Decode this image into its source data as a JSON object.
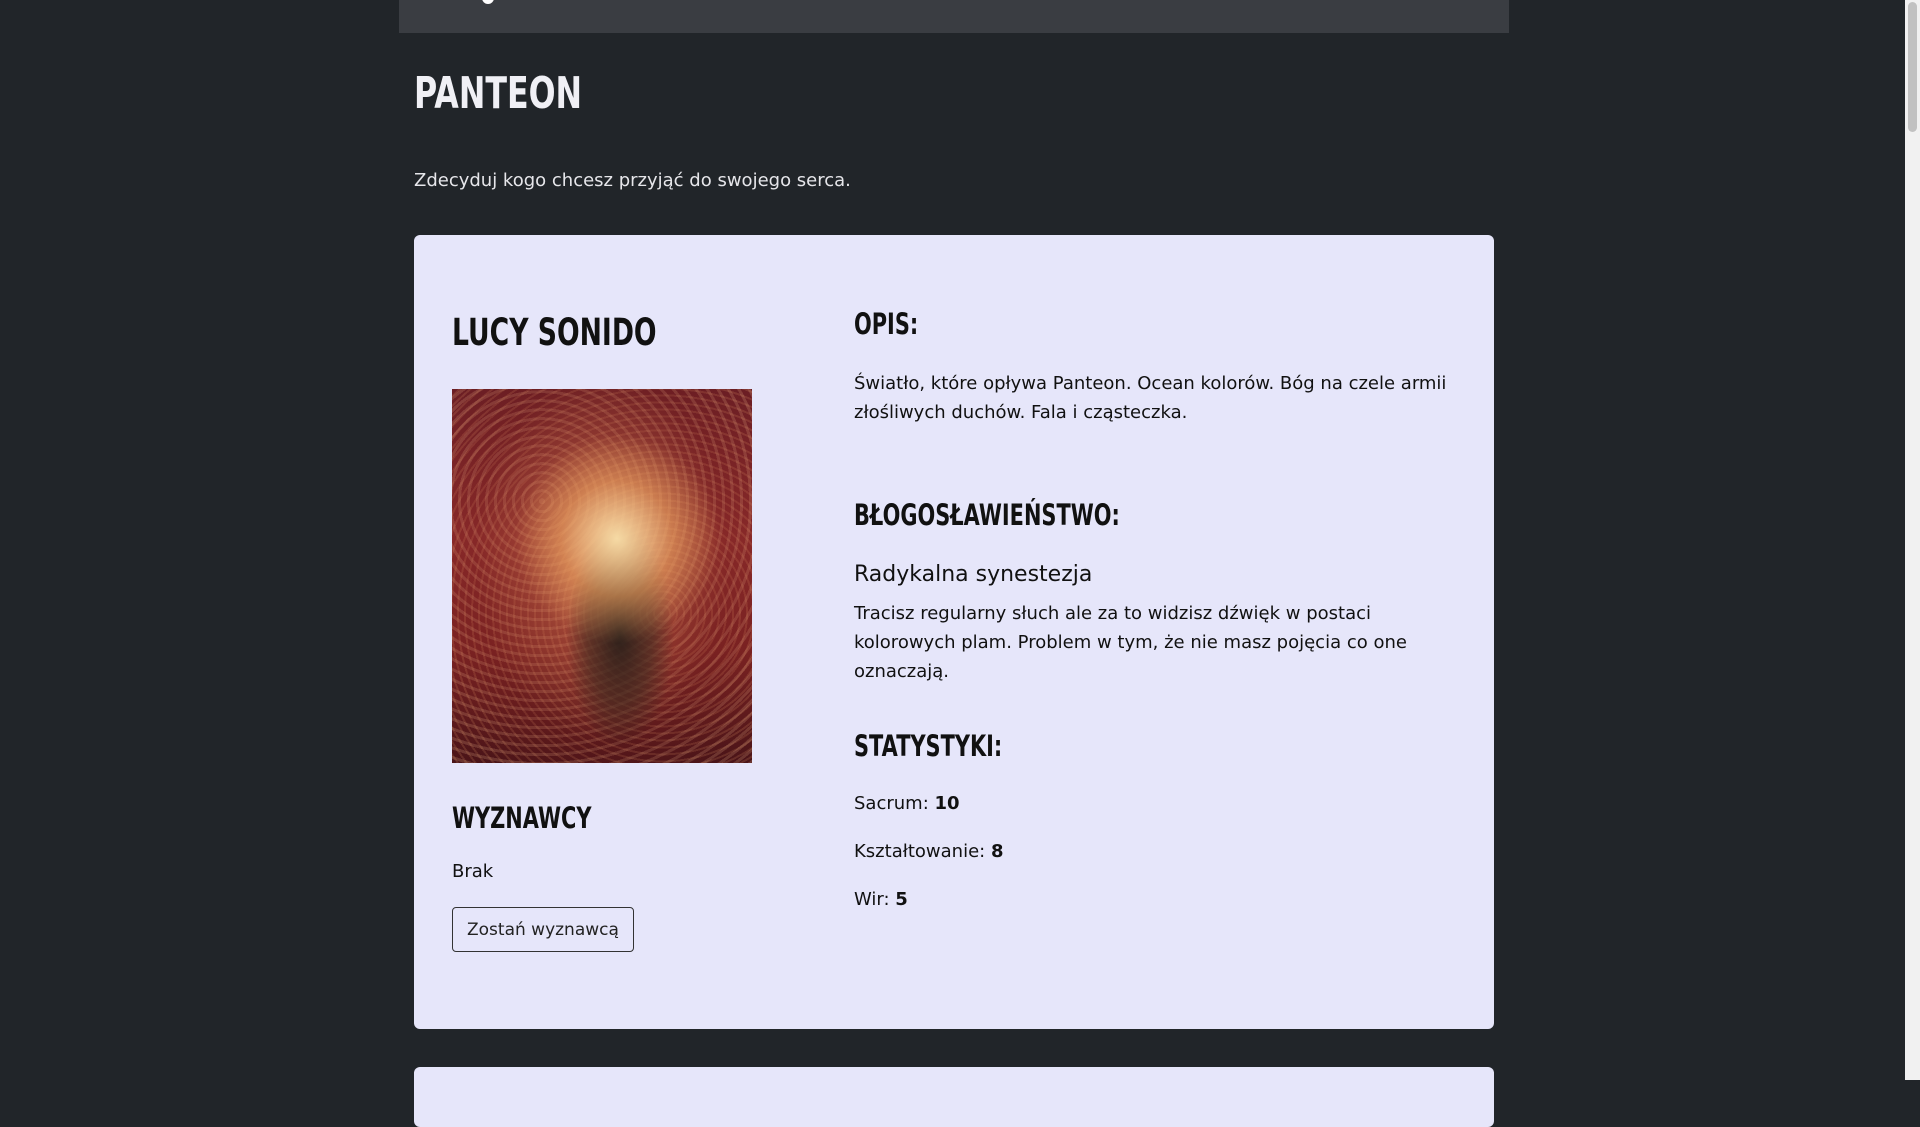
{
  "page": {
    "title": "PANTEON",
    "subtitle": "Zdecyduj kogo chcesz przyjąć do swojego serca."
  },
  "god": {
    "name": "LUCY SONIDO",
    "image_alt": "Lucy Sonido",
    "followers_heading": "WYZNAWCY",
    "followers_value": "Brak",
    "follow_button_label": "Zostań wyznawcą",
    "description_heading": "OPIS:",
    "description": "Światło, które opływa Panteon. Ocean kolorów. Bóg na czele armii złośliwych duchów. Fala i cząsteczka.",
    "blessing_heading": "BŁOGOSŁAWIEŃSTWO:",
    "blessing_name": "Radykalna synestezja",
    "blessing_description": "Tracisz regularny słuch ale za to widzisz dźwięk w postaci kolorowych plam. Problem w tym, że nie masz pojęcia co one oznaczają.",
    "stats_heading": "STATYSTYKI:",
    "stats": [
      {
        "label": "Sacrum:",
        "value": "10"
      },
      {
        "label": "Kształtowanie:",
        "value": "8"
      },
      {
        "label": "Wir:",
        "value": "5"
      }
    ]
  },
  "colors": {
    "background": "#212529",
    "card": "#e6e6fa",
    "topbar": "#3a3d42"
  }
}
